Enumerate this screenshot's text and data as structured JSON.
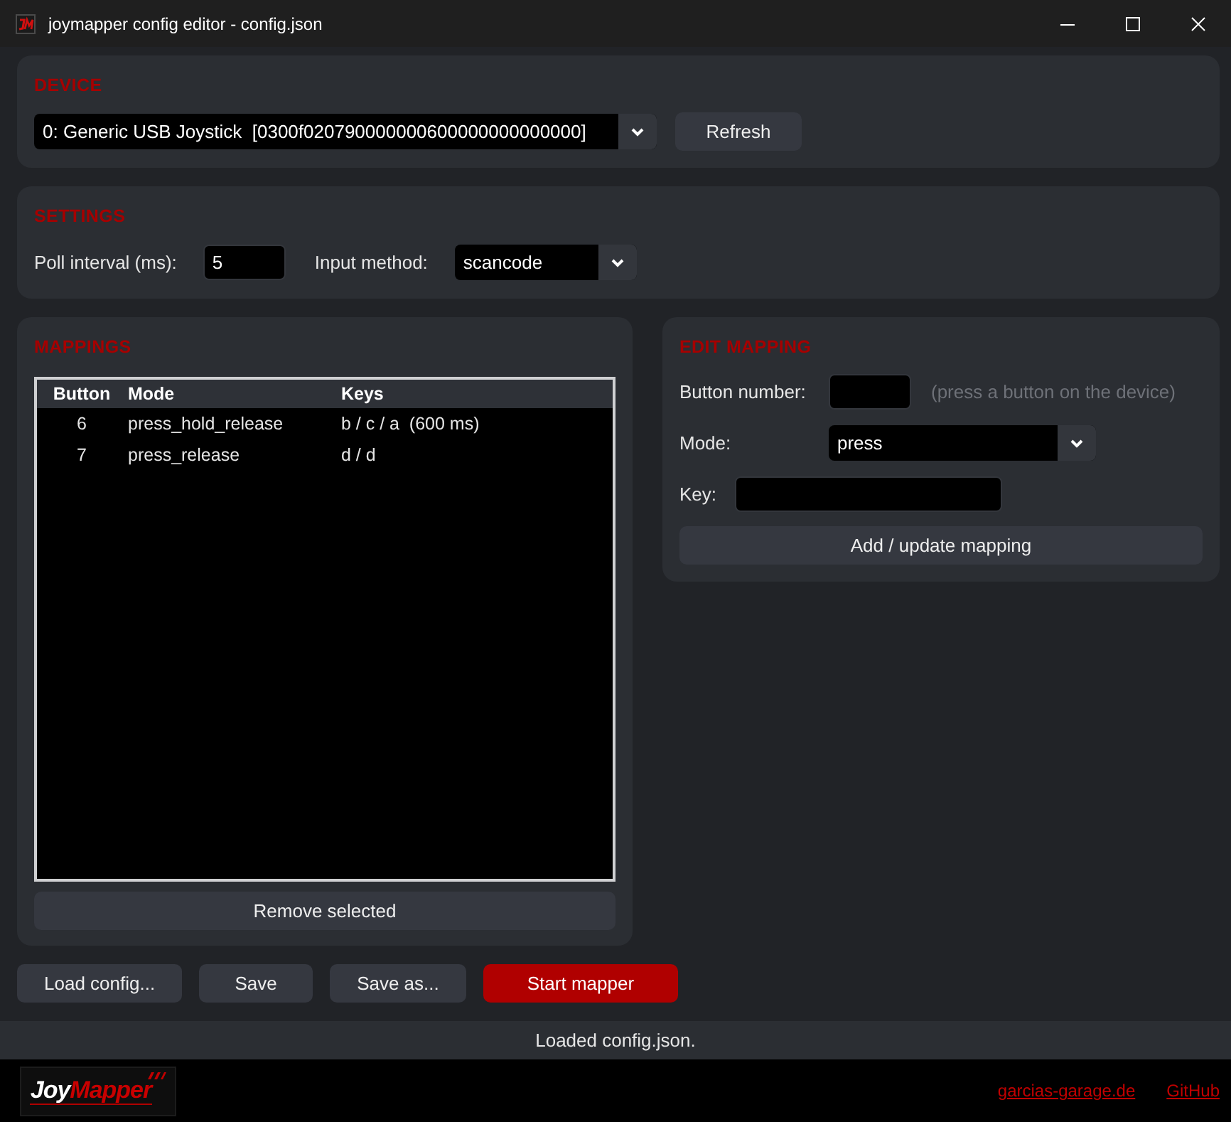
{
  "window": {
    "title": "joymapper config editor - config.json"
  },
  "device": {
    "heading": "DEVICE",
    "select": {
      "value": "0: Generic USB Joystick  [0300f020790000000600000000000000]"
    },
    "refresh_button": {
      "label": "Refresh"
    }
  },
  "settings": {
    "heading": "SETTINGS",
    "fields": [
      {
        "kind": "number",
        "label": "Poll interval (ms):",
        "value": "5"
      },
      {
        "kind": "select",
        "label": "Input method:",
        "value": "scancode"
      }
    ]
  },
  "mappings": {
    "heading": "MAPPINGS",
    "table": {
      "columns": [
        "Button",
        "Mode",
        "Keys"
      ],
      "rows": [
        {
          "cells": [
            "6",
            "press_hold_release",
            "b / c / a  (600 ms)"
          ],
          "selected": false
        },
        {
          "cells": [
            "7",
            "press_release",
            "d / d"
          ],
          "selected": false
        }
      ]
    },
    "remove_button": {
      "label": "Remove selected"
    }
  },
  "edit_mapping": {
    "heading": "EDIT MAPPING",
    "fields": [
      {
        "kind": "number",
        "label": "Button number:",
        "note": "(press a button on the device)"
      },
      {
        "kind": "select",
        "label": "Mode:",
        "value": "press"
      },
      {
        "kind": "text",
        "label": "Key:"
      }
    ],
    "submit_button": {
      "label": "Add / update mapping"
    }
  },
  "actions": [
    {
      "kind": "default",
      "label": "Load config..."
    },
    {
      "kind": "default",
      "label": "Save"
    },
    {
      "kind": "default",
      "label": "Save as..."
    },
    {
      "kind": "primary",
      "label": "Start mapper"
    }
  ],
  "status_bar": {
    "text": "Loaded config.json."
  },
  "footer": {
    "logo": {
      "parts": [
        "Joy",
        "Mapper"
      ]
    },
    "links": [
      "garcias-garage.de",
      "GitHub"
    ]
  }
}
